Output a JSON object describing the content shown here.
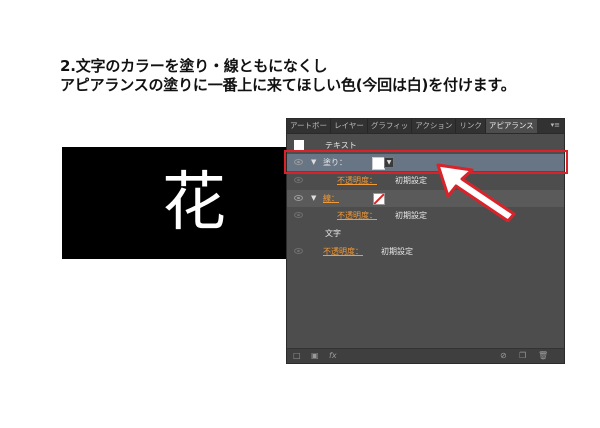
{
  "instructions": {
    "line1": "2.文字のカラーを塗り・線ともになくし",
    "line2": "アピアランスの塗りに一番上に来てほしい色(今回は白)を付けます。"
  },
  "canvas": {
    "glyph": "花"
  },
  "panel": {
    "tabs": [
      "アートボー",
      "レイヤー",
      "グラフィッ",
      "アクション",
      "リンク",
      "アピアランス"
    ],
    "menu_glyph": "▾≡",
    "object_label": "テキスト",
    "fill_label": "塗り：",
    "stroke_label": "線：",
    "opacity_label": "不透明度：",
    "opacity_value": "初期設定",
    "text_label": "文字",
    "fill_color": "#ffffff",
    "stroke_color": "none"
  },
  "colors": {
    "highlight": "#d8232a",
    "panel_bg": "#4d4d4d",
    "selected_row": "#687585",
    "orange_label": "#f29a38"
  },
  "icons": [
    "eye-icon",
    "disclosure-triangle-icon",
    "chevron-down-icon",
    "new-stroke-icon",
    "new-fill-icon",
    "fx-icon",
    "clear-icon",
    "duplicate-icon",
    "trash-icon"
  ]
}
